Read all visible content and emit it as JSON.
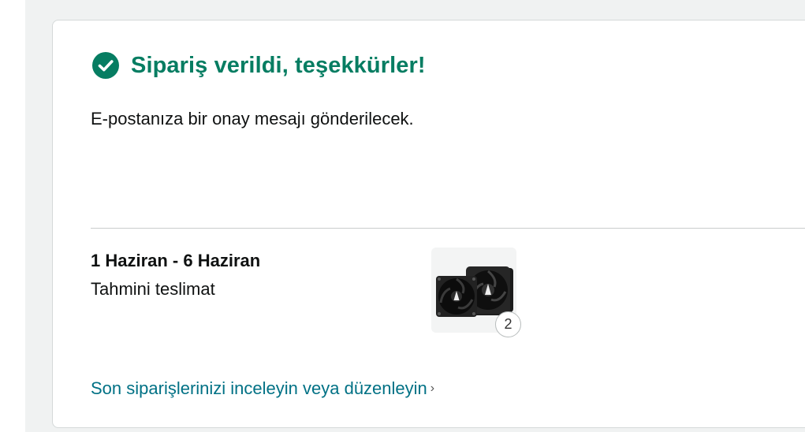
{
  "confirmation": {
    "title": "Sipariş verildi, teşekkürler!",
    "message": "E-postanıza bir onay mesajı gönderilecek.",
    "icon": "check-circle-icon",
    "accent_color": "#067d62"
  },
  "delivery": {
    "date_range": "1 Haziran - 6 Haziran",
    "label": "Tahmini teslimat",
    "item_quantity": "2",
    "item_image": "cpu-case-fans-image"
  },
  "orders_link": {
    "label": "Son siparişlerinizi inceleyin veya düzenleyin",
    "chevron": "›",
    "color": "#007185"
  }
}
